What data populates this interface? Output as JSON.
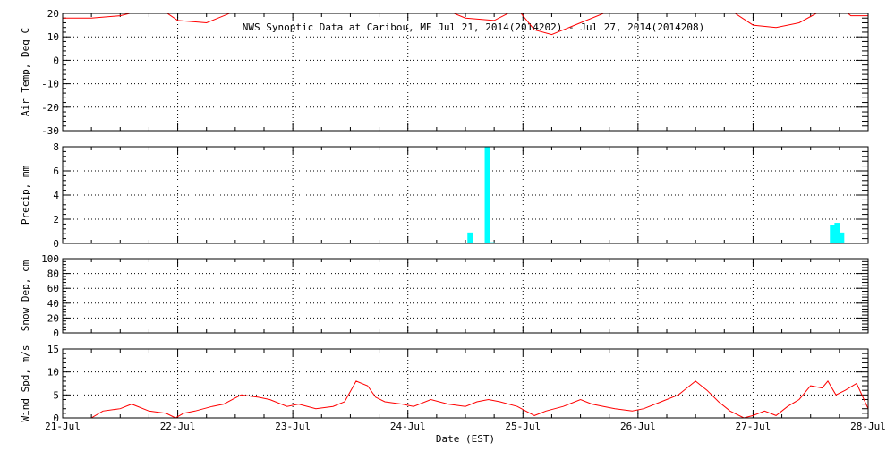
{
  "title": "NWS Synoptic Data at Caribou, ME   Jul 21, 2014(2014202) - Jul 27, 2014(2014208)",
  "xlabel": "Date (EST)",
  "x_tick_labels": [
    "21-Jul",
    "22-Jul",
    "23-Jul",
    "24-Jul",
    "25-Jul",
    "26-Jul",
    "27-Jul",
    "28-Jul"
  ],
  "colors": {
    "line": "#ff0000",
    "bar": "#00ffff",
    "axis": "#000000"
  },
  "chart_data": [
    {
      "type": "line",
      "ylabel": "Air Temp, Deg C",
      "ylim": [
        -30,
        20
      ],
      "yticks": [
        -30,
        -20,
        -10,
        0,
        10,
        20
      ],
      "grid": true,
      "series": [
        {
          "x": [
            0,
            0.25,
            0.5,
            0.75,
            0.85,
            1.0,
            1.25,
            1.5,
            1.75,
            2.0,
            2.5,
            3.0,
            3.25,
            3.5,
            3.75,
            3.95,
            4.1,
            4.25,
            4.5,
            4.75,
            5.0,
            5.25,
            5.5,
            5.75,
            6.0,
            6.2,
            6.4,
            6.55,
            6.75,
            6.85,
            7.0
          ],
          "y": [
            18,
            18,
            19,
            22,
            22,
            17,
            16,
            21,
            22,
            22,
            24,
            25,
            23,
            18,
            17,
            22,
            13,
            11,
            16,
            21,
            22,
            22,
            24,
            23,
            15,
            14,
            16,
            20,
            23,
            19,
            19
          ]
        }
      ]
    },
    {
      "type": "bar",
      "ylabel": "Precip, mm",
      "ylim": [
        0,
        8
      ],
      "yticks": [
        0,
        2,
        4,
        6,
        8
      ],
      "grid": true,
      "x": [
        3.54,
        3.69,
        3.73,
        6.69,
        6.73,
        6.77
      ],
      "values": [
        0.9,
        8.0,
        0.1,
        1.5,
        1.7,
        0.9
      ]
    },
    {
      "type": "line",
      "ylabel": "Snow Dep, cm",
      "ylim": [
        0,
        100
      ],
      "yticks": [
        0,
        20,
        40,
        60,
        80,
        100
      ],
      "grid": true,
      "series": []
    },
    {
      "type": "line",
      "ylabel": "Wind Spd, m/s",
      "ylim": [
        0,
        15
      ],
      "yticks": [
        0,
        5,
        10,
        15
      ],
      "grid": true,
      "series": [
        {
          "x": [
            0,
            0.25,
            0.35,
            0.5,
            0.6,
            0.75,
            0.9,
            0.98,
            1.05,
            1.15,
            1.3,
            1.4,
            1.55,
            1.7,
            1.8,
            1.95,
            2.05,
            2.2,
            2.35,
            2.45,
            2.55,
            2.65,
            2.72,
            2.8,
            2.95,
            3.05,
            3.2,
            3.35,
            3.5,
            3.6,
            3.7,
            3.8,
            3.95,
            4.1,
            4.2,
            4.35,
            4.5,
            4.6,
            4.7,
            4.8,
            4.95,
            5.05,
            5.2,
            5.35,
            5.5,
            5.6,
            5.7,
            5.8,
            5.92,
            6.0,
            6.1,
            6.2,
            6.3,
            6.4,
            6.5,
            6.6,
            6.65,
            6.72,
            6.8,
            6.9,
            7.0
          ],
          "y": [
            0,
            0,
            1.5,
            2,
            3,
            1.5,
            1,
            0,
            1,
            1.5,
            2.5,
            3,
            5,
            4.5,
            4,
            2.5,
            3,
            2,
            2.5,
            3.5,
            8,
            7,
            4.5,
            3.5,
            3,
            2.5,
            4,
            3,
            2.5,
            3.5,
            4,
            3.5,
            2.5,
            0.5,
            1.5,
            2.5,
            4,
            3,
            2.5,
            2,
            1.5,
            2,
            3.5,
            5,
            8,
            6,
            3.5,
            1.5,
            0,
            0.5,
            1.5,
            0.5,
            2.5,
            4,
            7,
            6.5,
            8,
            5,
            6,
            7.5,
            2
          ]
        }
      ]
    }
  ]
}
